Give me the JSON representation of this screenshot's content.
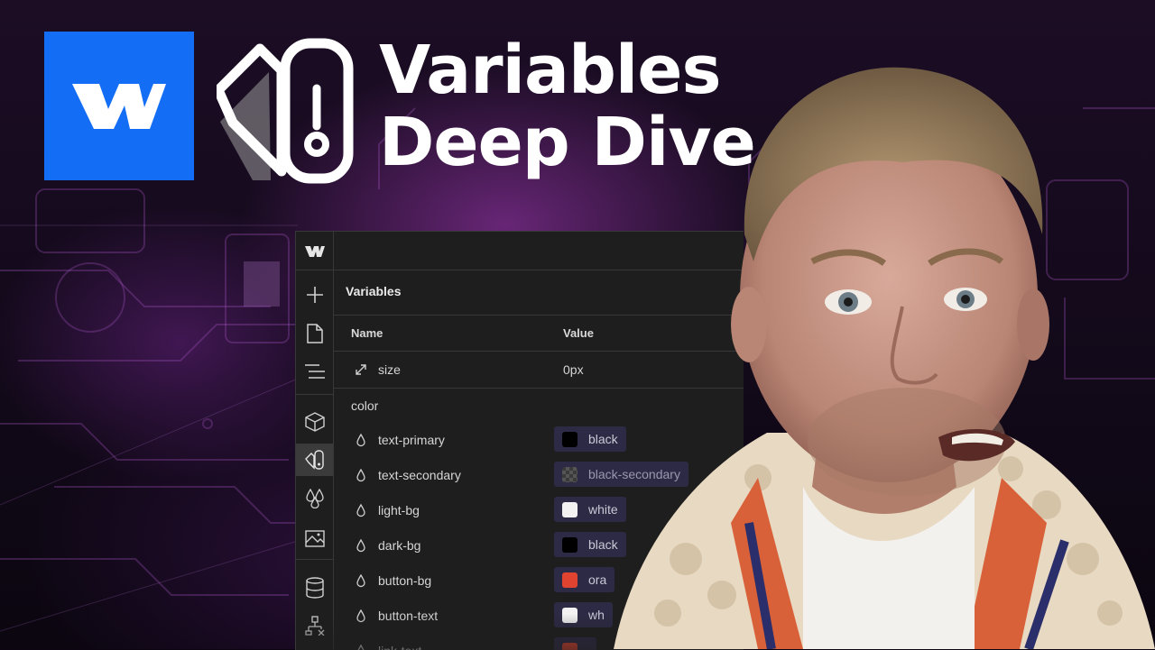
{
  "thumbnail": {
    "title_line1": "Variables",
    "title_line2": "Deep Dive"
  },
  "panel": {
    "heading": "Variables",
    "columns": {
      "name": "Name",
      "value": "Value"
    },
    "size_row": {
      "name": "size",
      "value": "0px"
    },
    "group": "color",
    "color_rows": [
      {
        "name": "text-primary",
        "value": "black",
        "swatch": "#000000"
      },
      {
        "name": "text-secondary",
        "value": "black-secondary",
        "swatch": "#4a4a4a"
      },
      {
        "name": "light-bg",
        "value": "white",
        "swatch": "#f2f2f2"
      },
      {
        "name": "dark-bg",
        "value": "black",
        "swatch": "#000000"
      },
      {
        "name": "button-bg",
        "value": "ora",
        "swatch": "#e0432f"
      },
      {
        "name": "button-text",
        "value": "wh",
        "swatch": "#f2f2f2"
      },
      {
        "name": "link-text",
        "value": "",
        "swatch": "#e0432f"
      }
    ],
    "rail_icons": [
      "webflow-logo-icon",
      "add-icon",
      "page-icon",
      "navigator-icon",
      "components-icon",
      "variables-icon",
      "styles-icon",
      "assets-icon",
      "cms-icon",
      "logic-icon"
    ]
  },
  "colors": {
    "webflow_blue": "#146ef5",
    "accent_purple": "#a43cbe"
  }
}
